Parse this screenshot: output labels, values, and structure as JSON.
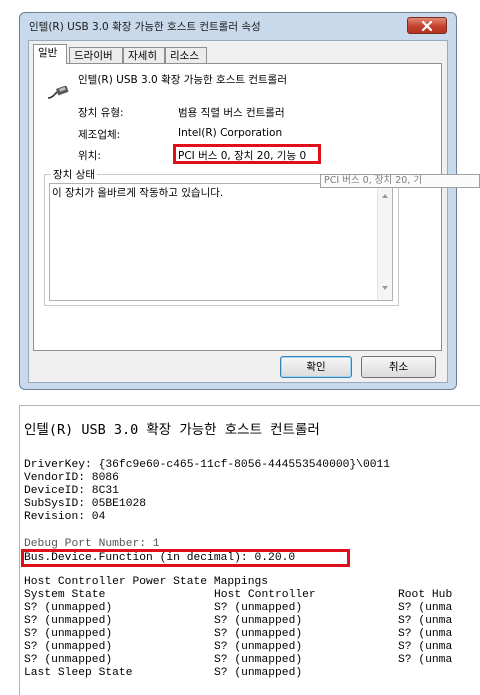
{
  "dialog": {
    "title": "인텔(R) USB 3.0 확장 가능한 호스트 컨트롤러 속성",
    "tabs": [
      "일반",
      "드라이버",
      "자세히",
      "리소스"
    ],
    "device_name": "인텔(R) USB 3.0 확장 가능한 호스트 컨트롤러",
    "device_icon": "usb-connector-icon",
    "properties": [
      {
        "label": "장치 유형:",
        "value": "범용 직렬 버스 컨트롤러"
      },
      {
        "label": "제조업체:",
        "value": "Intel(R) Corporation"
      },
      {
        "label": "위치:",
        "value": "PCI 버스 0, 장치 20, 기능 0"
      }
    ],
    "status_group_label": "장치 상태",
    "status_text": "이 장치가 올바르게 작동하고 있습니다.",
    "tooltip": "PCI 버스 0, 장치 20, 기",
    "ok_label": "확인",
    "cancel_label": "취소",
    "highlight_color": "#e0101a"
  },
  "console": {
    "title": "인텔(R) USB 3.0 확장 가능한 호스트 컨트롤러",
    "lines": [
      "DriverKey: {36fc9e60-c465-11cf-8056-444553540000}\\0011",
      "VendorID: 8086",
      "DeviceID: 8C31",
      "SubSysID: 05BE1028",
      "Revision: 04"
    ],
    "partial_line": "Debug Port Number: 1",
    "highlight_line": "Bus.Device.Function (in decimal): 0.20.0",
    "power_header": "Host Controller Power State Mappings",
    "columns": [
      "System State",
      "Host Controller",
      "Root Hub"
    ],
    "rows": [
      {
        "state": "S? (unmapped)",
        "hc": "S? (unmapped)",
        "hub": "S? (unma"
      },
      {
        "state": "S? (unmapped)",
        "hc": "S? (unmapped)",
        "hub": "S? (unma"
      },
      {
        "state": "S? (unmapped)",
        "hc": "S? (unmapped)",
        "hub": "S? (unma"
      },
      {
        "state": "S? (unmapped)",
        "hc": "S? (unmapped)",
        "hub": "S? (unma"
      },
      {
        "state": "S? (unmapped)",
        "hc": "S? (unmapped)",
        "hub": "S? (unma"
      }
    ],
    "last_sleep": {
      "label": "Last Sleep State",
      "value": "S? (unmapped)"
    }
  }
}
